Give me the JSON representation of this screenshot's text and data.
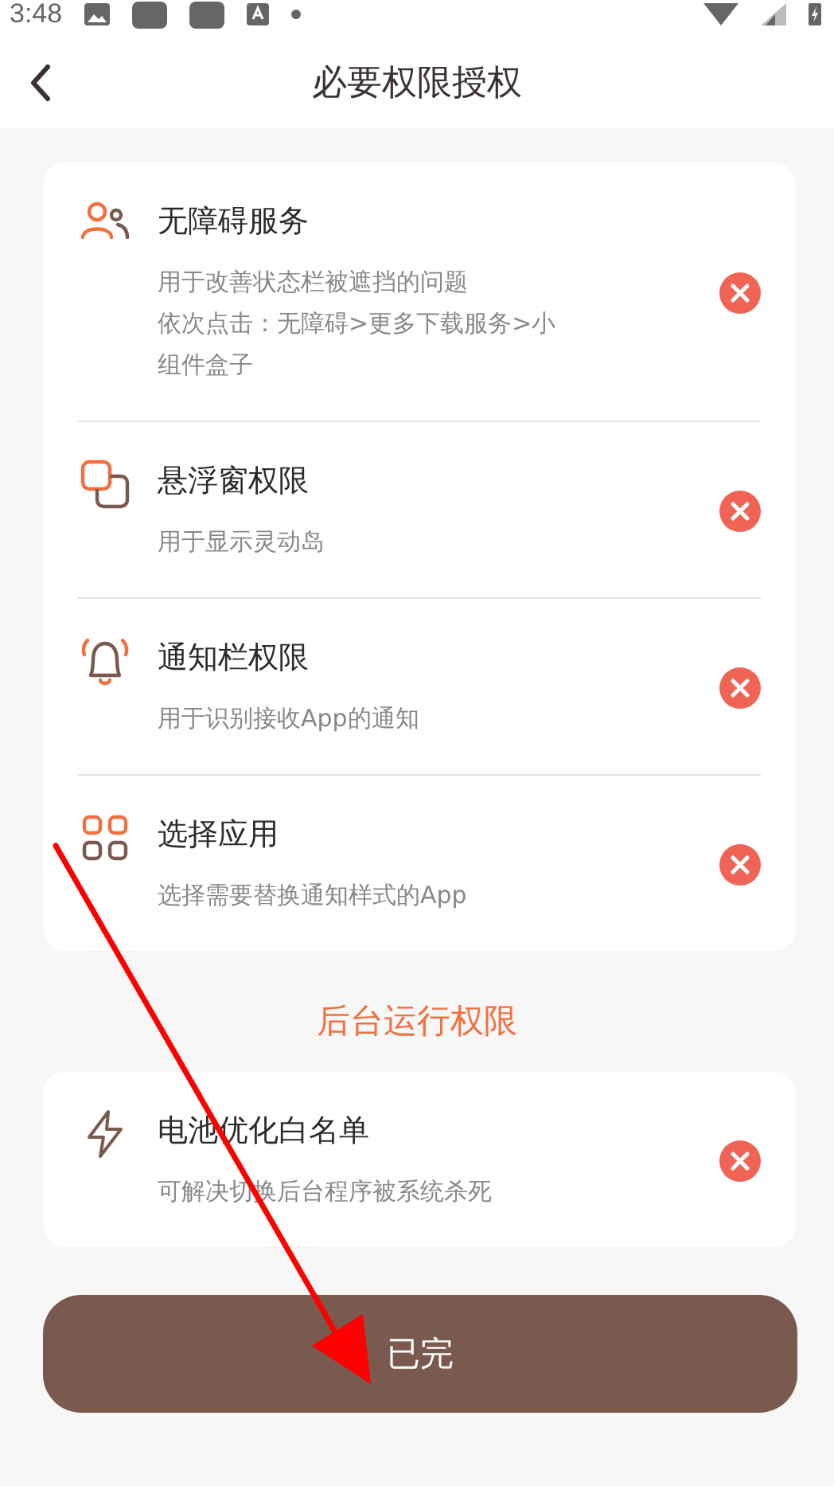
{
  "status_bar": {
    "time": "3:48"
  },
  "header": {
    "title": "必要权限授权"
  },
  "permissions": [
    {
      "kind": "people",
      "title": "无障碍服务",
      "description": [
        "用于改善状态栏被遮挡的问题",
        "依次点击：无障碍>更多下载服务>小组件盒子"
      ],
      "granted": false
    },
    {
      "kind": "windows",
      "title": "悬浮窗权限",
      "description": "用于显示灵动岛",
      "granted": false
    },
    {
      "kind": "bell",
      "title": "通知栏权限",
      "description": "用于识别接收App的通知",
      "granted": false
    },
    {
      "kind": "grid",
      "title": "选择应用",
      "description": "选择需要替换通知样式的App",
      "granted": false
    }
  ],
  "background_section": {
    "title": "后台运行权限",
    "items": [
      {
        "kind": "bolt",
        "title": "电池优化白名单",
        "description": "可解决切换后台程序被系统杀死",
        "granted": false
      }
    ]
  },
  "done_button": {
    "label": "已完"
  }
}
